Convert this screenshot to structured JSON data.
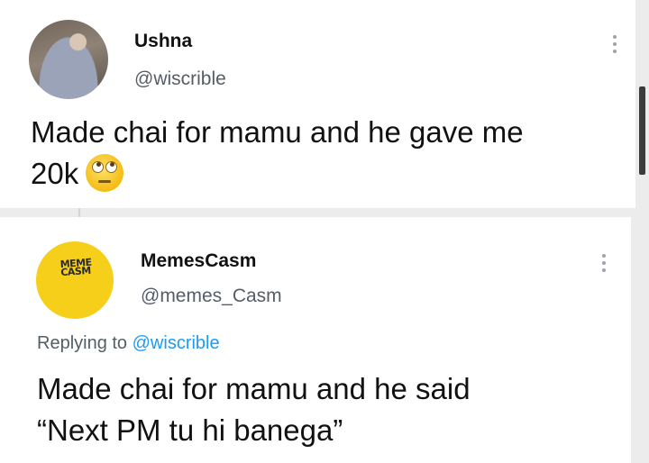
{
  "tweets": [
    {
      "name": "Ushna",
      "handle": "@wiscrible",
      "text_line1": "Made chai for mamu and he gave me",
      "text_line2": "20k",
      "emoji": "face-with-rolling-eyes"
    },
    {
      "name": "MemesCasm",
      "handle": "@memes_Casm",
      "logo_text": "MEME CASM",
      "replying_prefix": "Replying to",
      "replying_to": "@wiscrible",
      "text_line1": "Made chai for mamu and he said",
      "text_line2": "“Next PM tu hi banega”"
    }
  ],
  "colors": {
    "mention": "#1d9bf0",
    "secondary_text": "#555d66",
    "memescasm_avatar": "#f6cf1a"
  }
}
